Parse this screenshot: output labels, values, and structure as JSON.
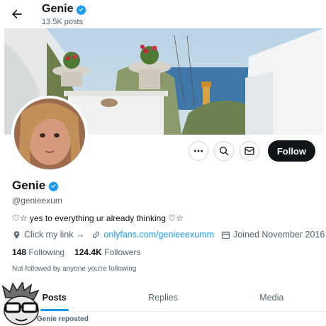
{
  "header": {
    "name": "Genie",
    "posts": "13.5K posts"
  },
  "profile": {
    "name": "Genie",
    "handle": "@genieexum",
    "bio": "♡☆ yes to everything ur already thinking ♡☆",
    "link_label": "Click my link →",
    "website": "onlyfans.com/genieeexumm",
    "joined": "Joined November 2016",
    "following_count": "148",
    "following_label": "Following",
    "followers_count": "124.4K",
    "followers_label": "Followers",
    "not_followed": "Not followed by anyone you're following"
  },
  "actions": {
    "follow_label": "Follow"
  },
  "tabs": [
    {
      "label": "Posts"
    },
    {
      "label": "Replies"
    },
    {
      "label": "Media"
    }
  ],
  "feed": {
    "repost_label": "Genie reposted"
  },
  "colors": {
    "accent": "#1d9bf0",
    "text": "#0f1419",
    "muted": "#536471"
  }
}
